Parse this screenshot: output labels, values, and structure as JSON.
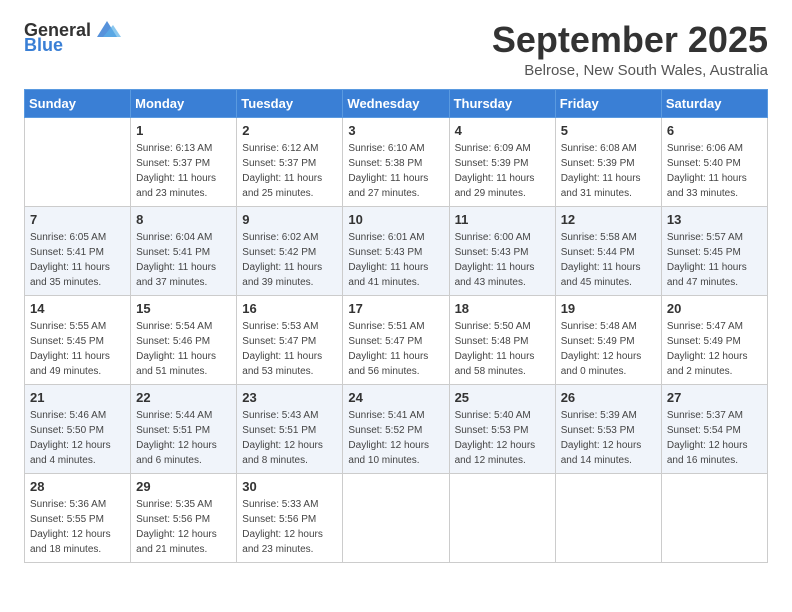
{
  "logo": {
    "general": "General",
    "blue": "Blue"
  },
  "title": "September 2025",
  "location": "Belrose, New South Wales, Australia",
  "days_of_week": [
    "Sunday",
    "Monday",
    "Tuesday",
    "Wednesday",
    "Thursday",
    "Friday",
    "Saturday"
  ],
  "weeks": [
    [
      {
        "day": "",
        "sunrise": "",
        "sunset": "",
        "daylight": ""
      },
      {
        "day": "1",
        "sunrise": "Sunrise: 6:13 AM",
        "sunset": "Sunset: 5:37 PM",
        "daylight": "Daylight: 11 hours and 23 minutes."
      },
      {
        "day": "2",
        "sunrise": "Sunrise: 6:12 AM",
        "sunset": "Sunset: 5:37 PM",
        "daylight": "Daylight: 11 hours and 25 minutes."
      },
      {
        "day": "3",
        "sunrise": "Sunrise: 6:10 AM",
        "sunset": "Sunset: 5:38 PM",
        "daylight": "Daylight: 11 hours and 27 minutes."
      },
      {
        "day": "4",
        "sunrise": "Sunrise: 6:09 AM",
        "sunset": "Sunset: 5:39 PM",
        "daylight": "Daylight: 11 hours and 29 minutes."
      },
      {
        "day": "5",
        "sunrise": "Sunrise: 6:08 AM",
        "sunset": "Sunset: 5:39 PM",
        "daylight": "Daylight: 11 hours and 31 minutes."
      },
      {
        "day": "6",
        "sunrise": "Sunrise: 6:06 AM",
        "sunset": "Sunset: 5:40 PM",
        "daylight": "Daylight: 11 hours and 33 minutes."
      }
    ],
    [
      {
        "day": "7",
        "sunrise": "Sunrise: 6:05 AM",
        "sunset": "Sunset: 5:41 PM",
        "daylight": "Daylight: 11 hours and 35 minutes."
      },
      {
        "day": "8",
        "sunrise": "Sunrise: 6:04 AM",
        "sunset": "Sunset: 5:41 PM",
        "daylight": "Daylight: 11 hours and 37 minutes."
      },
      {
        "day": "9",
        "sunrise": "Sunrise: 6:02 AM",
        "sunset": "Sunset: 5:42 PM",
        "daylight": "Daylight: 11 hours and 39 minutes."
      },
      {
        "day": "10",
        "sunrise": "Sunrise: 6:01 AM",
        "sunset": "Sunset: 5:43 PM",
        "daylight": "Daylight: 11 hours and 41 minutes."
      },
      {
        "day": "11",
        "sunrise": "Sunrise: 6:00 AM",
        "sunset": "Sunset: 5:43 PM",
        "daylight": "Daylight: 11 hours and 43 minutes."
      },
      {
        "day": "12",
        "sunrise": "Sunrise: 5:58 AM",
        "sunset": "Sunset: 5:44 PM",
        "daylight": "Daylight: 11 hours and 45 minutes."
      },
      {
        "day": "13",
        "sunrise": "Sunrise: 5:57 AM",
        "sunset": "Sunset: 5:45 PM",
        "daylight": "Daylight: 11 hours and 47 minutes."
      }
    ],
    [
      {
        "day": "14",
        "sunrise": "Sunrise: 5:55 AM",
        "sunset": "Sunset: 5:45 PM",
        "daylight": "Daylight: 11 hours and 49 minutes."
      },
      {
        "day": "15",
        "sunrise": "Sunrise: 5:54 AM",
        "sunset": "Sunset: 5:46 PM",
        "daylight": "Daylight: 11 hours and 51 minutes."
      },
      {
        "day": "16",
        "sunrise": "Sunrise: 5:53 AM",
        "sunset": "Sunset: 5:47 PM",
        "daylight": "Daylight: 11 hours and 53 minutes."
      },
      {
        "day": "17",
        "sunrise": "Sunrise: 5:51 AM",
        "sunset": "Sunset: 5:47 PM",
        "daylight": "Daylight: 11 hours and 56 minutes."
      },
      {
        "day": "18",
        "sunrise": "Sunrise: 5:50 AM",
        "sunset": "Sunset: 5:48 PM",
        "daylight": "Daylight: 11 hours and 58 minutes."
      },
      {
        "day": "19",
        "sunrise": "Sunrise: 5:48 AM",
        "sunset": "Sunset: 5:49 PM",
        "daylight": "Daylight: 12 hours and 0 minutes."
      },
      {
        "day": "20",
        "sunrise": "Sunrise: 5:47 AM",
        "sunset": "Sunset: 5:49 PM",
        "daylight": "Daylight: 12 hours and 2 minutes."
      }
    ],
    [
      {
        "day": "21",
        "sunrise": "Sunrise: 5:46 AM",
        "sunset": "Sunset: 5:50 PM",
        "daylight": "Daylight: 12 hours and 4 minutes."
      },
      {
        "day": "22",
        "sunrise": "Sunrise: 5:44 AM",
        "sunset": "Sunset: 5:51 PM",
        "daylight": "Daylight: 12 hours and 6 minutes."
      },
      {
        "day": "23",
        "sunrise": "Sunrise: 5:43 AM",
        "sunset": "Sunset: 5:51 PM",
        "daylight": "Daylight: 12 hours and 8 minutes."
      },
      {
        "day": "24",
        "sunrise": "Sunrise: 5:41 AM",
        "sunset": "Sunset: 5:52 PM",
        "daylight": "Daylight: 12 hours and 10 minutes."
      },
      {
        "day": "25",
        "sunrise": "Sunrise: 5:40 AM",
        "sunset": "Sunset: 5:53 PM",
        "daylight": "Daylight: 12 hours and 12 minutes."
      },
      {
        "day": "26",
        "sunrise": "Sunrise: 5:39 AM",
        "sunset": "Sunset: 5:53 PM",
        "daylight": "Daylight: 12 hours and 14 minutes."
      },
      {
        "day": "27",
        "sunrise": "Sunrise: 5:37 AM",
        "sunset": "Sunset: 5:54 PM",
        "daylight": "Daylight: 12 hours and 16 minutes."
      }
    ],
    [
      {
        "day": "28",
        "sunrise": "Sunrise: 5:36 AM",
        "sunset": "Sunset: 5:55 PM",
        "daylight": "Daylight: 12 hours and 18 minutes."
      },
      {
        "day": "29",
        "sunrise": "Sunrise: 5:35 AM",
        "sunset": "Sunset: 5:56 PM",
        "daylight": "Daylight: 12 hours and 21 minutes."
      },
      {
        "day": "30",
        "sunrise": "Sunrise: 5:33 AM",
        "sunset": "Sunset: 5:56 PM",
        "daylight": "Daylight: 12 hours and 23 minutes."
      },
      {
        "day": "",
        "sunrise": "",
        "sunset": "",
        "daylight": ""
      },
      {
        "day": "",
        "sunrise": "",
        "sunset": "",
        "daylight": ""
      },
      {
        "day": "",
        "sunrise": "",
        "sunset": "",
        "daylight": ""
      },
      {
        "day": "",
        "sunrise": "",
        "sunset": "",
        "daylight": ""
      }
    ]
  ]
}
